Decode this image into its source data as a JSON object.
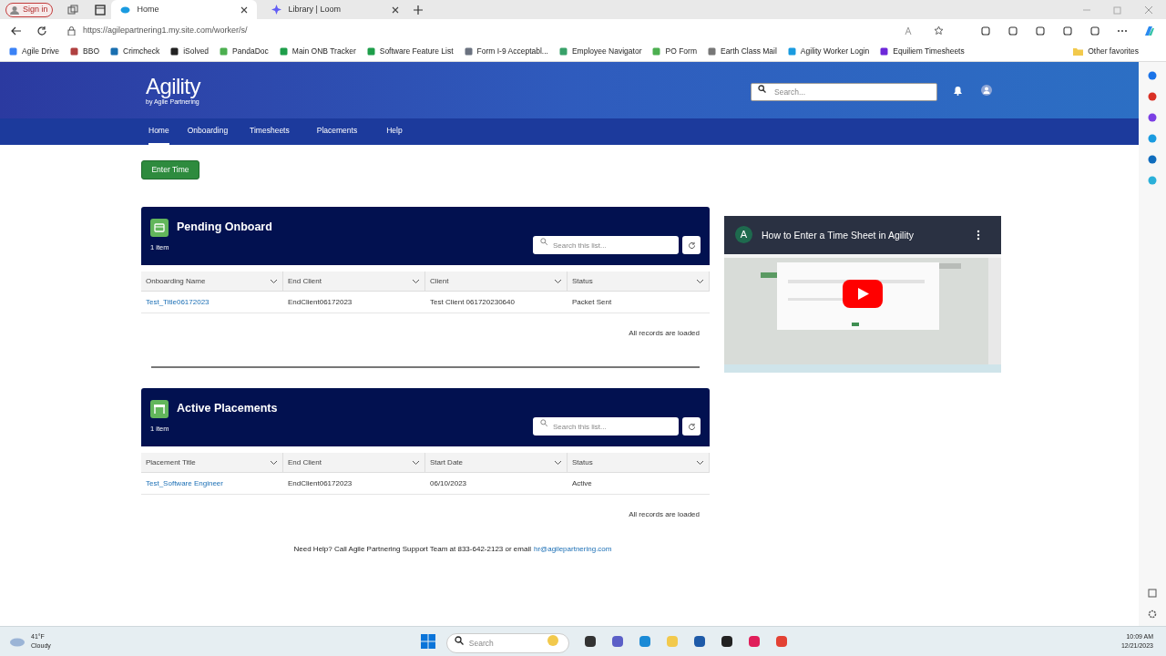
{
  "browser": {
    "profile": "Sign in",
    "tabs": [
      {
        "title": "Home",
        "selected": true
      },
      {
        "title": "Library | Loom",
        "selected": false
      }
    ],
    "url": "https://agilepartnering1.my.site.com/worker/s/",
    "bookmarks": [
      "Agile Drive",
      "BBO",
      "Crimcheck",
      "iSolved",
      "PandaDoc",
      "Main ONB Tracker",
      "Software Feature List",
      "Form I-9 Acceptabl...",
      "Employee Navigator",
      "PO Form",
      "Earth Class Mail",
      "Agility Worker Login",
      "Equiliem Timesheets"
    ],
    "other_favorites": "Other favorites"
  },
  "site": {
    "logo": "Agility",
    "tagline": "by Agile Partnering",
    "search_placeholder": "Search...",
    "nav": [
      {
        "label": "Home",
        "selected": true
      },
      {
        "label": "Onboarding",
        "selected": false
      },
      {
        "label": "Timesheets",
        "selected": false
      },
      {
        "label": "Placements",
        "selected": false
      },
      {
        "label": "Help",
        "selected": false
      }
    ],
    "enter_time": "Enter Time",
    "cards": [
      {
        "title": "Pending Onboard",
        "count": "1 item",
        "search_placeholder": "Search this list...",
        "columns": [
          "Onboarding Name",
          "End Client",
          "Client",
          "Status"
        ],
        "rows": [
          [
            "Test_Title06172023",
            "EndClient06172023",
            "Test Client 061720230640",
            "Packet Sent"
          ]
        ],
        "footer": "All records are loaded"
      },
      {
        "title": "Active Placements",
        "count": "1 item",
        "search_placeholder": "Search this list...",
        "columns": [
          "Placement Title",
          "End Client",
          "Start Date",
          "Status"
        ],
        "rows": [
          [
            "Test_Software Engineer",
            "EndClient06172023",
            "06/10/2023",
            "Active"
          ]
        ],
        "footer": "All records are loaded"
      }
    ],
    "video": {
      "channel_initial": "A",
      "title": "How to Enter a Time Sheet in Agility"
    },
    "help": {
      "text": "Need Help? Call Agile Partnering Support Team at 833-642-2123 or email",
      "email": "hr@agilepartnering.com"
    }
  },
  "taskbar": {
    "temperature": "41°F",
    "condition": "Cloudy",
    "search_placeholder": "Search",
    "time": "10:09 AM",
    "date": "12/21/2023"
  }
}
